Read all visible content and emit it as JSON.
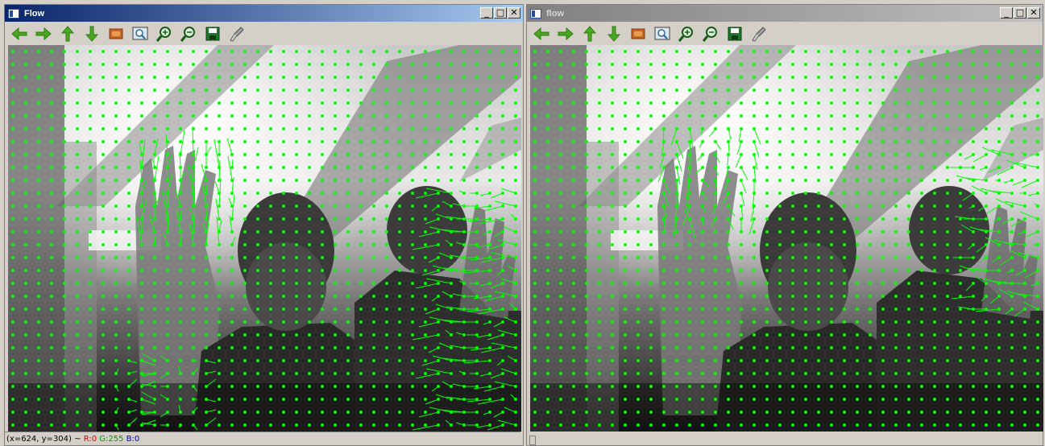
{
  "windows": [
    {
      "title": "Flow",
      "status": {
        "coords": "(x=624, y=304) ~",
        "r": "R:0",
        "g": "G:255",
        "b": "B:0"
      }
    },
    {
      "title": "flow"
    }
  ],
  "window_controls": {
    "minimize": "_",
    "maximize": "□",
    "close": "✕"
  },
  "toolbar_icons": [
    "pan-left-icon",
    "pan-right-icon",
    "pan-up-icon",
    "pan-down-icon",
    "zoom-reset-icon",
    "zoom-fit-icon",
    "zoom-in-icon",
    "zoom-out-icon",
    "save-icon",
    "properties-icon"
  ],
  "colors": {
    "flow_vector": "#00ff00",
    "title_active": "#0a246a",
    "title_inactive": "#808080"
  }
}
